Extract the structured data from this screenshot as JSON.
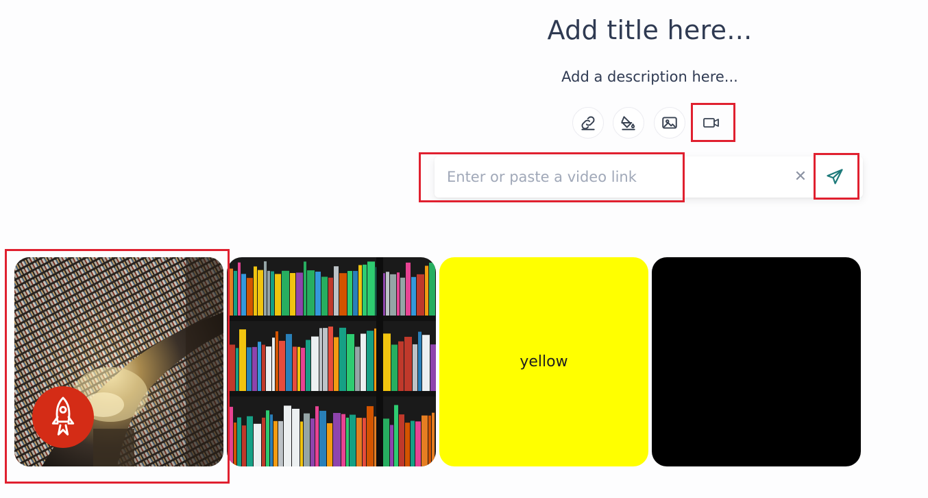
{
  "header": {
    "title": "Add title here...",
    "description": "Add a description here..."
  },
  "toolbar": {
    "buttons": [
      {
        "name": "link",
        "icon": "link-icon"
      },
      {
        "name": "fill",
        "icon": "paint-bucket-icon"
      },
      {
        "name": "image",
        "icon": "image-icon"
      },
      {
        "name": "video",
        "icon": "video-camera-icon",
        "active": true
      }
    ]
  },
  "video_link_input": {
    "placeholder": "Enter or paste a video link",
    "value": "",
    "clear_label": "✕"
  },
  "tiles": [
    {
      "type": "image",
      "subject": "tunnel-bookstore",
      "badge_icon": "rocket-icon"
    },
    {
      "type": "image",
      "subject": "bookshelf"
    },
    {
      "type": "color",
      "label": "yellow",
      "color": "#ffff00"
    },
    {
      "type": "color",
      "color": "#000000"
    }
  ],
  "colors": {
    "accent": "#1d7a7a",
    "highlight": "#e0202f",
    "badge": "#d42c16"
  }
}
